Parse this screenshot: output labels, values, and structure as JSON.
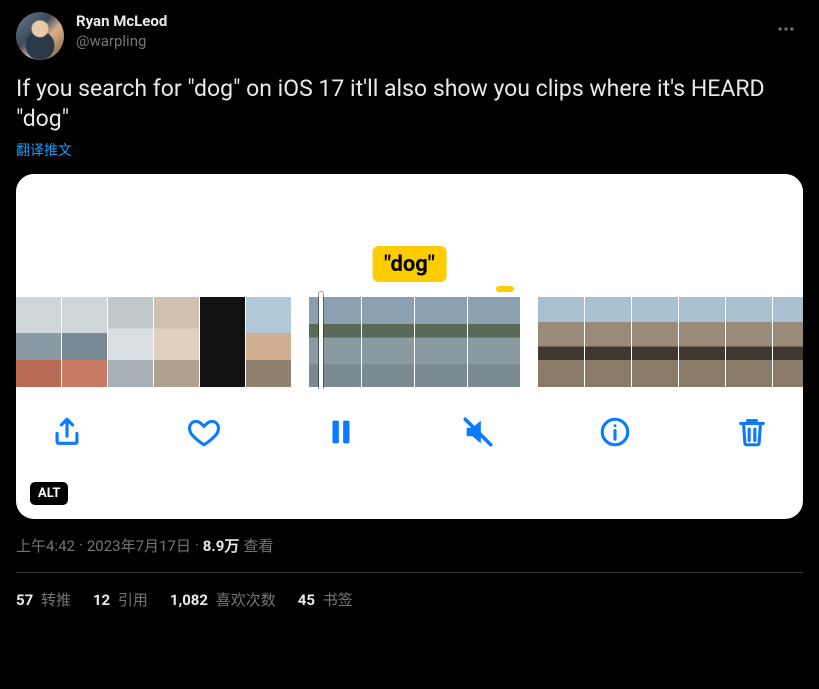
{
  "author": {
    "display_name": "Ryan McLeod",
    "handle": "@warpling"
  },
  "tweet_text": "If you search for \"dog\" on iOS 17 it'll also show you clips where it's HEARD \"dog\"",
  "translate_label": "翻译推文",
  "media": {
    "search_bubble": "\"dog\"",
    "alt_badge": "ALT"
  },
  "meta": {
    "time": "上午4:42",
    "dot1": " · ",
    "date": "2023年7月17日",
    "dot2": " · ",
    "views_number": "8.9万",
    "views_label": " 查看"
  },
  "stats": {
    "retweets": {
      "count": "57",
      "label": " 转推"
    },
    "quotes": {
      "count": "12",
      "label": " 引用"
    },
    "likes": {
      "count": "1,082",
      "label": " 喜欢次数"
    },
    "bookmarks": {
      "count": "45",
      "label": " 书签"
    }
  }
}
